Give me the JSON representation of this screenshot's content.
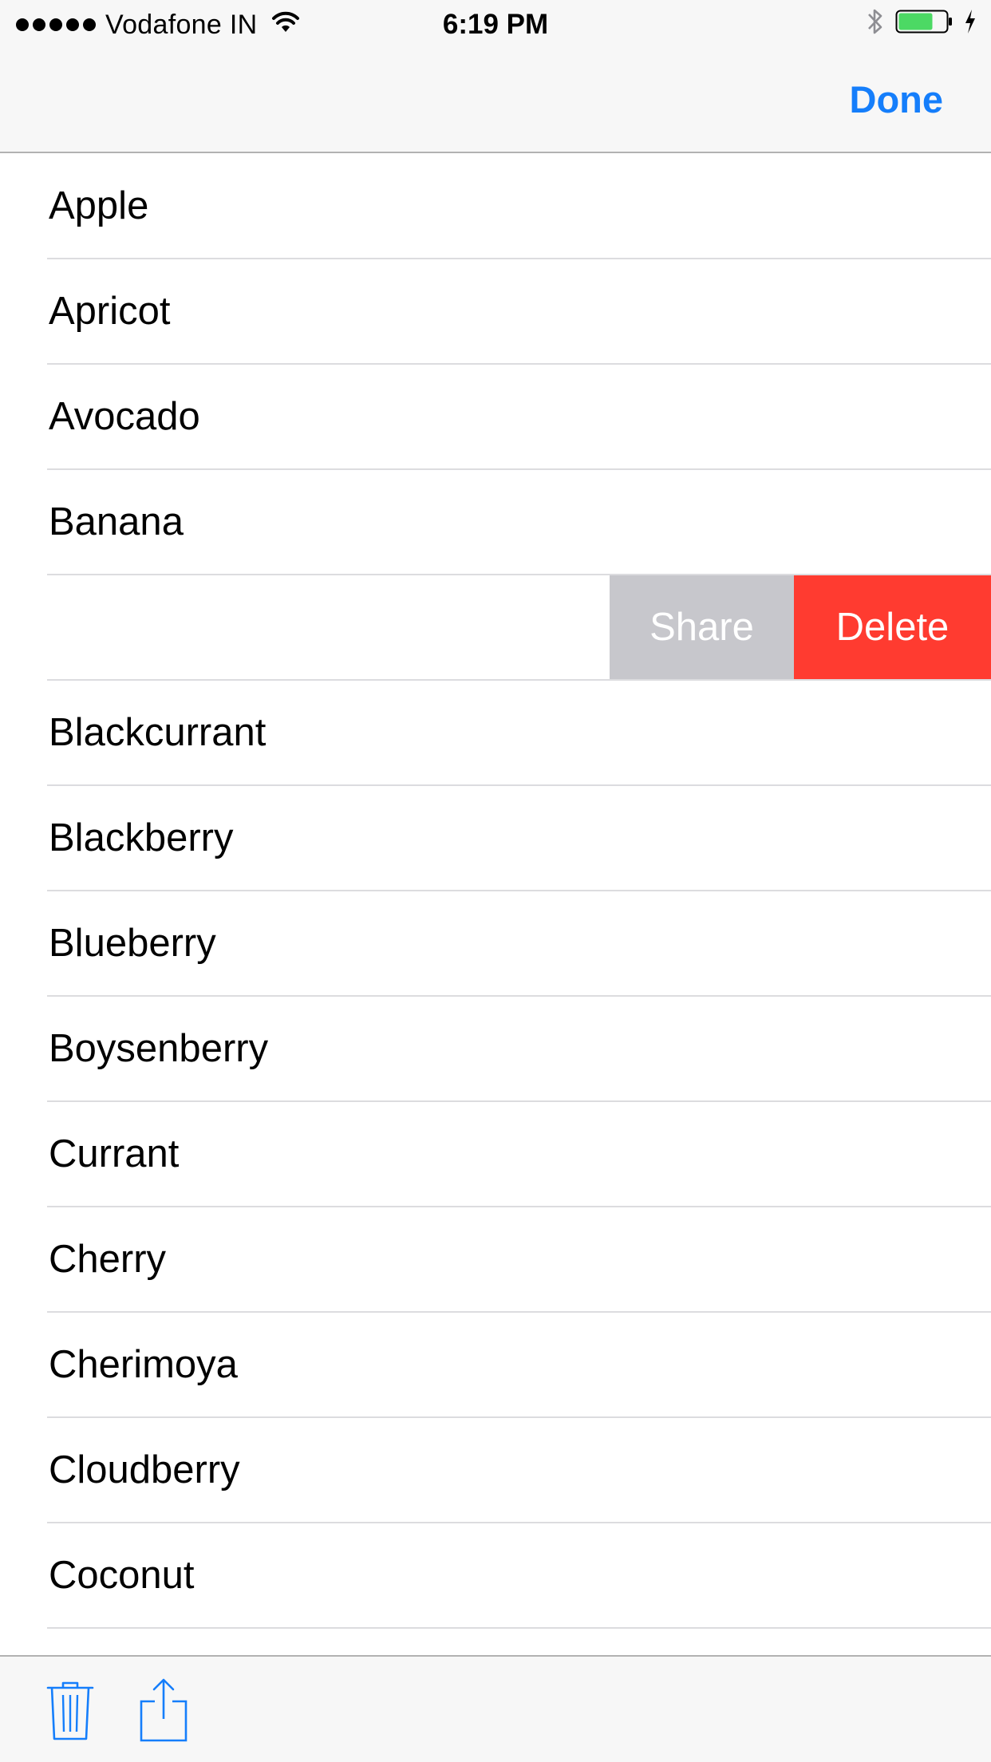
{
  "status_bar": {
    "carrier": "Vodafone IN",
    "time": "6:19 PM",
    "battery_color": "#4cd964",
    "icons": [
      "signal-dots-icon",
      "wifi-icon",
      "bluetooth-icon",
      "battery-icon",
      "charging-bolt-icon"
    ]
  },
  "nav": {
    "done_label": "Done",
    "accent_color": "#157efb"
  },
  "rows": [
    {
      "label": "Apple"
    },
    {
      "label": "Apricot"
    },
    {
      "label": "Avocado"
    },
    {
      "label": "Banana"
    },
    {
      "label": ""
    },
    {
      "label": "Blackcurrant"
    },
    {
      "label": "Blackberry"
    },
    {
      "label": "Blueberry"
    },
    {
      "label": "Boysenberry"
    },
    {
      "label": "Currant"
    },
    {
      "label": "Cherry"
    },
    {
      "label": "Cherimoya"
    },
    {
      "label": "Cloudberry"
    },
    {
      "label": "Coconut"
    }
  ],
  "swipe": {
    "share_label": "Share",
    "delete_label": "Delete",
    "share_color": "#c7c7cc",
    "delete_color": "#ff3b30"
  },
  "toolbar": {
    "icons": [
      "trash-icon",
      "share-icon"
    ]
  }
}
